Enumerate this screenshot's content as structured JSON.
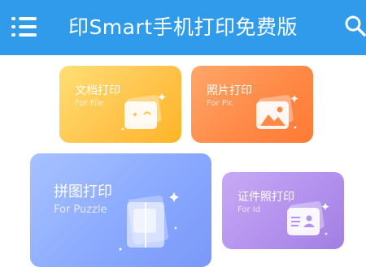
{
  "app": {
    "title": "印Smart手机打印免费版"
  },
  "icons": {
    "menu": "menu-icon",
    "search": "search-icon"
  },
  "cards": {
    "doc": {
      "title": "文档打印",
      "subtitle": "For File",
      "icon": "document-icon"
    },
    "photo": {
      "title": "照片打印",
      "subtitle": "For Pic",
      "icon": "picture-icon"
    },
    "puzzle": {
      "title": "拼图打印",
      "subtitle": "For Puzzle",
      "icon": "puzzle-icon"
    },
    "id": {
      "title": "证件照打印",
      "subtitle": "For Id",
      "icon": "id-card-icon"
    }
  },
  "colors": {
    "topbar": "#2f9bea",
    "doc": "#ffc44c",
    "photo": "#ff8a47",
    "puzzle": "#8aa9ff",
    "id": "#b391ee"
  }
}
